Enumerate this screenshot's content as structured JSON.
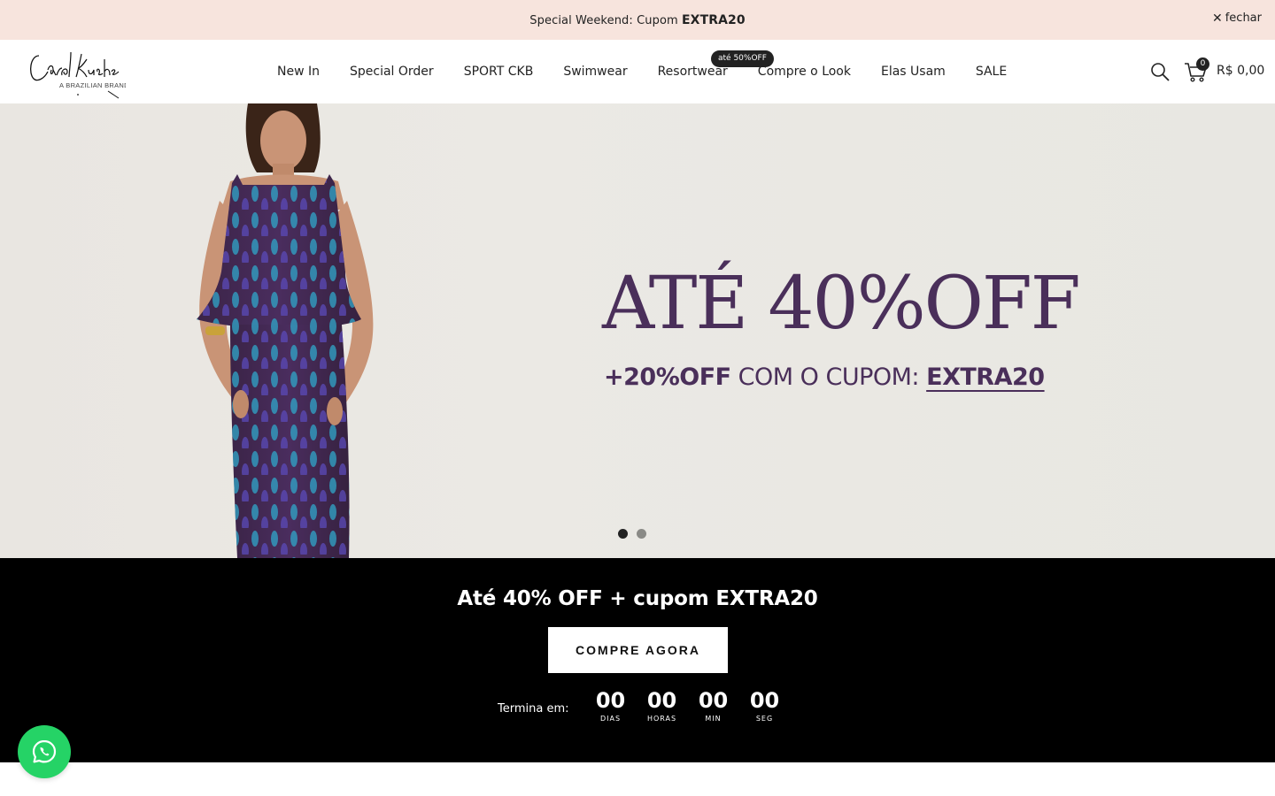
{
  "announcement": {
    "text": "Special Weekend: Cupom ",
    "code": "EXTRA20",
    "close_label": "fechar"
  },
  "header": {
    "logo_text": "Carol Kucher",
    "logo_tagline": "A BRAZILIAN BRAND",
    "nav": [
      {
        "label": "New In"
      },
      {
        "label": "Special Order"
      },
      {
        "label": "SPORT CKB"
      },
      {
        "label": "Swimwear"
      },
      {
        "label": "Resortwear"
      },
      {
        "label": "Compre o Look"
      },
      {
        "label": "Elas Usam"
      },
      {
        "label": "SALE"
      }
    ],
    "sale_badge": "até 50%OFF",
    "cart_count": "0",
    "cart_total": "R$ 0,00",
    "icons": {
      "search": "search-icon",
      "cart": "cart-icon"
    }
  },
  "hero": {
    "title": "ATÉ 40%OFF",
    "sub_strong": "+20%OFF",
    "sub_text": " COM O CUPOM: ",
    "sub_coupon": "EXTRA20",
    "slide_count": 2,
    "active_slide": 1,
    "colors": {
      "headline": "#4a2f5a",
      "background": "#e9e6e1"
    }
  },
  "promo": {
    "title": "Até 40% OFF + cupom EXTRA20",
    "button_label": "COMPRE AGORA",
    "countdown_label": "Termina em:",
    "countdown": [
      {
        "value": "00",
        "caption": "DIAS"
      },
      {
        "value": "00",
        "caption": "HORAS"
      },
      {
        "value": "00",
        "caption": "MIN"
      },
      {
        "value": "00",
        "caption": "SEG"
      }
    ]
  },
  "whatsapp": {
    "icon": "whatsapp-icon",
    "color": "#25d366"
  }
}
